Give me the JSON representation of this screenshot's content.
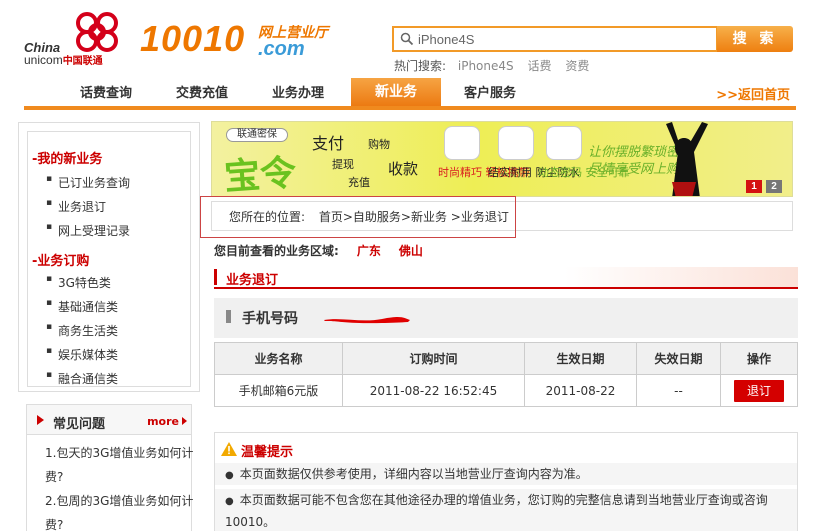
{
  "header": {
    "logo_china": "China",
    "logo_unicom": "unicom",
    "logo_cn": "中国联通",
    "brand_number": "10010",
    "brand_sub": "网上营业厅",
    "brand_com": ".com",
    "search_value": "iPhone4S",
    "search_button": "搜 索",
    "hot_label": "热门搜索:",
    "hot_terms": [
      "iPhone4S",
      "话费",
      "资费"
    ]
  },
  "nav": {
    "items": [
      "话费查询",
      "交费充值",
      "业务办理",
      "新业务",
      "客户服务"
    ],
    "home": ">>返回首页"
  },
  "sidebar": {
    "sections": [
      {
        "title": "-我的新业务",
        "items": [
          "已订业务查询",
          "业务退订",
          "网上受理记录"
        ]
      },
      {
        "title": "-业务订购",
        "items": [
          "3G特色类",
          "基础通信类",
          "商务生活类",
          "娱乐媒体类",
          "融合通信类"
        ]
      }
    ],
    "faq": {
      "title": "常见问题",
      "more": "more",
      "questions": [
        "1.包天的3G增值业务如何计费?",
        "2.包周的3G增值业务如何计费?"
      ]
    }
  },
  "banner": {
    "logo": "联通密保",
    "big": "宝令",
    "words": [
      "支付",
      "购物",
      "提现",
      "充值",
      "收款"
    ],
    "features": [
      "时尚精巧\n轻松携带",
      "结实耐用\n防尘防水",
      "动态密码\n安全可靠"
    ],
    "slogan": "让你摆脱繁琐密码\n尽情享受网上购物",
    "pages": [
      "1",
      "2"
    ]
  },
  "location": {
    "label": "您所在的位置:",
    "path": "首页>自助服务>新业务 >业务退订"
  },
  "region": {
    "label": "您目前查看的业务区域:",
    "province": "广东",
    "city": "佛山"
  },
  "section_title": "业务退订",
  "phone_label": "手机号码",
  "table": {
    "headers": [
      "业务名称",
      "订购时间",
      "生效日期",
      "失效日期",
      "操作"
    ],
    "rows": [
      {
        "name": "手机邮箱6元版",
        "order_time": "2011-08-22 16:52:45",
        "effective": "2011-08-22",
        "expire": "--",
        "action": "退订"
      }
    ]
  },
  "tips": {
    "title": "温馨提示",
    "lines": [
      "本页面数据仅供参考使用，详细内容以当地营业厅查询内容为准。",
      "本页面数据可能不包含您在其他途径办理的增值业务，您订购的完整信息请到当地营业厅查询或咨询10010。"
    ]
  },
  "colors": {
    "accent": "#ee7700",
    "red": "#cc0000",
    "nav_active": "#ec7a12"
  }
}
